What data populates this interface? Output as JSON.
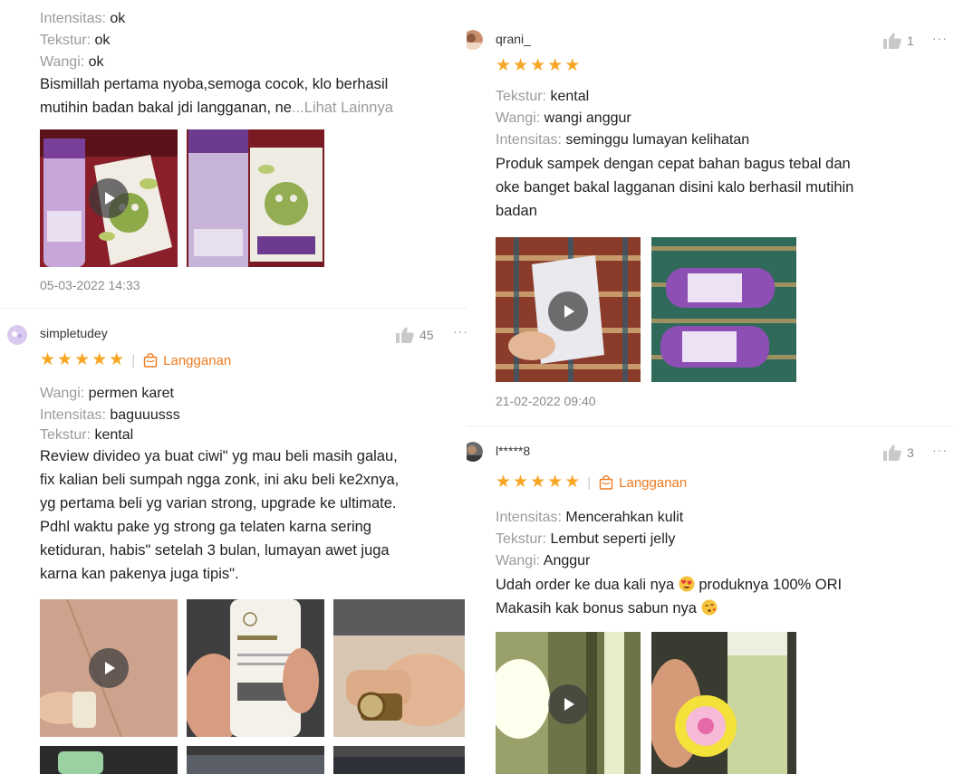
{
  "left_column": {
    "top_review": {
      "attributes": [
        {
          "key": "Intensitas: ",
          "value": "ok"
        },
        {
          "key": "Tekstur: ",
          "value": "ok"
        },
        {
          "key": "Wangi: ",
          "value": "ok"
        }
      ],
      "text_line1": "Bismillah pertama nyoba,semoga cocok, klo berhasil",
      "text_line2": "mutihin badan bakal jdi langganan, ne",
      "more_link": "...Lihat Lainnya",
      "date": "05-03-2022 14:33"
    },
    "review_simpletudey": {
      "username": "simpletudey",
      "likes": "45",
      "rating": 5,
      "badge": "Langganan",
      "attributes": [
        {
          "key": "Wangi: ",
          "value": "permen karet"
        },
        {
          "key": "Intensitas: ",
          "value": "baguuusss"
        },
        {
          "key": "Tekstur: ",
          "value": "kental"
        }
      ],
      "text_lines": [
        "Review divideo ya buat ciwi\" yg mau beli masih galau,",
        "fix kalian beli sumpah ngga zonk, ini aku beli ke2xnya,",
        "yg pertama beli yg varian strong, upgrade ke ultimate.",
        "Pdhl waktu pake yg strong ga telaten karna sering",
        "ketiduran, habis\" setelah 3 bulan, lumayan awet juga",
        "karna kan pakenya juga tipis\"."
      ]
    }
  },
  "right_column": {
    "review_qrani": {
      "username": "qrani_",
      "likes": "1",
      "rating": 5,
      "attributes": [
        {
          "key": "Tekstur: ",
          "value": "kental"
        },
        {
          "key": "Wangi: ",
          "value": "wangi anggur"
        },
        {
          "key": "Intensitas: ",
          "value": "seminggu lumayan kelihatan"
        }
      ],
      "text_lines": [
        "Produk sampek dengan cepat bahan bagus tebal dan",
        "oke banget bakal lagganan disini kalo berhasil mutihin",
        "badan"
      ],
      "date": "21-02-2022 09:40"
    },
    "review_l8": {
      "username": "l*****8",
      "likes": "3",
      "rating": 5,
      "badge": "Langganan",
      "attributes": [
        {
          "key": "Intensitas: ",
          "value": "Mencerahkan kulit"
        },
        {
          "key": "Tekstur: ",
          "value": "Lembut seperti jelly"
        },
        {
          "key": "Wangi: ",
          "value": "Anggur"
        }
      ],
      "text_line1a": "Udah order ke dua kali nya ",
      "text_line1b": " produknya 100% ORI",
      "text_line2": "Makasih kak bonus sabun nya "
    }
  },
  "ui": {
    "more_dots": "···",
    "star_glyph": "★",
    "separator": "|",
    "accent_color": "#f6a623",
    "badge_color": "#ee7a1d"
  }
}
